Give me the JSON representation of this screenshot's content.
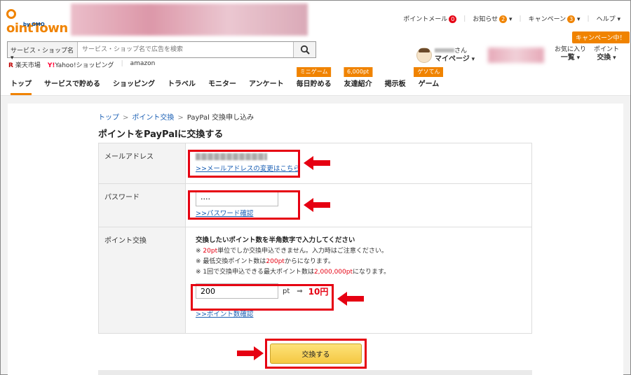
{
  "header": {
    "logo_text": "ointTown",
    "logo_sub": "by GMO",
    "toplinks": [
      {
        "label": "ポイントメール",
        "badge": "0",
        "badge_color": "#e60012"
      },
      {
        "label": "お知らせ",
        "badge": "2",
        "badge_color": "#f08300"
      },
      {
        "label": "キャンペーン",
        "badge": "3",
        "badge_color": "#f08300"
      },
      {
        "label": "ヘルプ"
      }
    ],
    "search": {
      "category": "サービス・ショップ名",
      "placeholder": "サービス・ショップ名で広告を検索"
    },
    "quicklinks": [
      "楽天市場",
      "Yahoo!ショッピング",
      "amazon"
    ],
    "mypage": {
      "san": "さん",
      "label": "マイページ"
    },
    "okini": {
      "line1": "お気に入り",
      "line2": "一覧"
    },
    "exchange": {
      "line1": "ポイント",
      "line2": "交換",
      "tag": "キャンペーン中！"
    },
    "nav": [
      {
        "label": "トップ",
        "active": true
      },
      {
        "label": "サービスで貯める"
      },
      {
        "label": "ショッピング"
      },
      {
        "label": "トラベル"
      },
      {
        "label": "モニター"
      },
      {
        "label": "アンケート"
      },
      {
        "label": "毎日貯める",
        "tag": "ミニゲーム"
      },
      {
        "label": "友達紹介",
        "tag": "6,000pt"
      },
      {
        "label": "掲示板"
      },
      {
        "label": "ゲーム",
        "tag": "ゲソてん"
      }
    ]
  },
  "breadcrumb": {
    "top": "トップ",
    "exchange": "ポイント交換",
    "current": "PayPal 交換申し込み"
  },
  "page_title": "ポイントをPayPalに交換する",
  "form": {
    "email": {
      "label": "メールアドレス",
      "change_link": ">>メールアドレスの変更はこちら"
    },
    "password": {
      "label": "パスワード",
      "value": "····",
      "confirm_link": ">>パスワード確認"
    },
    "points": {
      "label": "ポイント交換",
      "heading": "交換したいポイント数を半角数字で入力してください",
      "note1_pre": "※ ",
      "note1_red": "20pt",
      "note1_post": "単位でしか交換申込できません。入力時はご注意ください。",
      "note2_pre": "※ 最低交換ポイント数は",
      "note2_red": "200pt",
      "note2_post": "からになります。",
      "note3_pre": "※ 1回で交換申込できる最大ポイント数は",
      "note3_red": "2,000,000pt",
      "note3_post": "になります。",
      "value": "200",
      "unit": "pt",
      "arrow": "⇒",
      "yen": "10円",
      "confirm_link": ">>ポイント数確認"
    },
    "submit_label": "交換する"
  },
  "colors": {
    "brand": "#f08300",
    "highlight": "#e60012",
    "link": "#1a5fb4"
  }
}
